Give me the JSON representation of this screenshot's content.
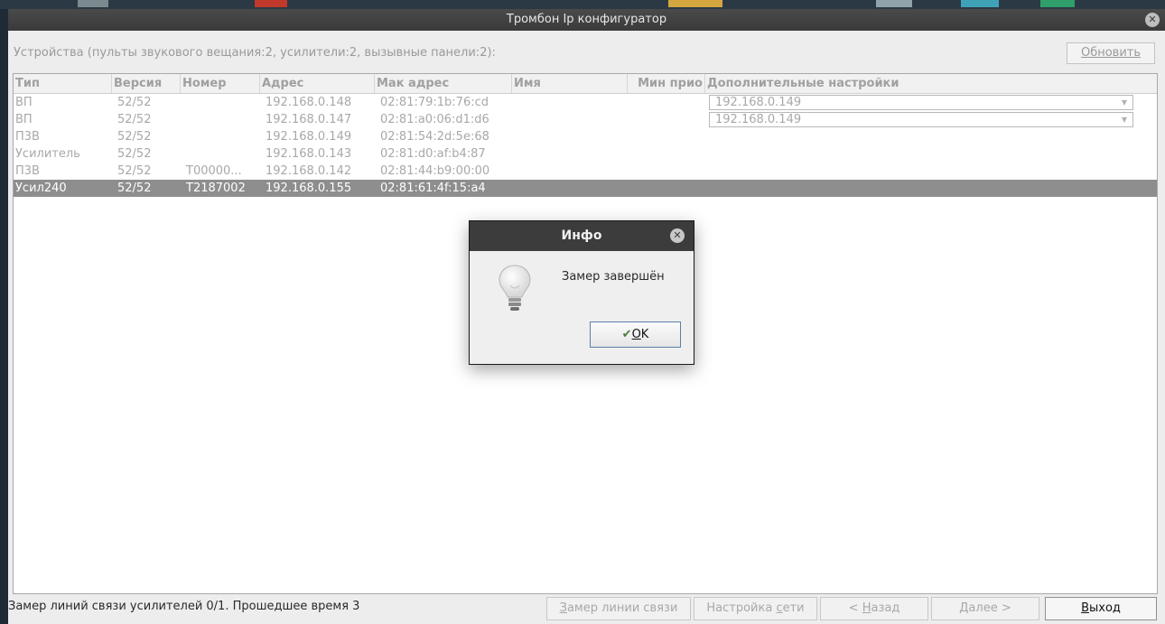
{
  "window": {
    "title": "Тромбон Ip конфигуратор",
    "close_glyph": "✕"
  },
  "devices_label": "Устройства (пульты звукового вещания:2, усилители:2, вызывные панели:2):",
  "refresh_button": "Обновить",
  "table": {
    "headers": [
      "Тип",
      "Версия",
      "Номер",
      "Адрес",
      "Мак адрес",
      "Имя",
      "Мин прио",
      "Дополнительные настройки"
    ],
    "rows": [
      {
        "type": "ВП",
        "version": "52/52",
        "number": "",
        "address": "192.168.0.148",
        "mac": "02:81:79:1b:76:cd",
        "name": "",
        "min_prio": "",
        "extra": "192.168.0.149"
      },
      {
        "type": "ВП",
        "version": "52/52",
        "number": "",
        "address": "192.168.0.147",
        "mac": "02:81:a0:06:d1:d6",
        "name": "",
        "min_prio": "",
        "extra": "192.168.0.149"
      },
      {
        "type": "П3В",
        "version": "52/52",
        "number": "",
        "address": "192.168.0.149",
        "mac": "02:81:54:2d:5e:68",
        "name": "",
        "min_prio": "",
        "extra": ""
      },
      {
        "type": "Усилитель",
        "version": "52/52",
        "number": "",
        "address": "192.168.0.143",
        "mac": "02:81:d0:af:b4:87",
        "name": "",
        "min_prio": "",
        "extra": ""
      },
      {
        "type": "П3В",
        "version": "52/52",
        "number": "T00000...",
        "address": "192.168.0.142",
        "mac": "02:81:44:b9:00:00",
        "name": "",
        "min_prio": "",
        "extra": ""
      },
      {
        "type": "Усил240",
        "version": "52/52",
        "number": "T2187002",
        "address": "192.168.0.155",
        "mac": "02:81:61:4f:15:a4",
        "name": "",
        "min_prio": "",
        "extra": ""
      }
    ],
    "selected_row": 5
  },
  "status_text": "Замер линий связи усилителей 0/1. Прошедшее время 3",
  "buttons": {
    "measure_pre": "",
    "measure_u": "З",
    "measure_post": "амер линии связи",
    "network_pre": "Настройка ",
    "network_u": "с",
    "network_post": "ети",
    "back_pre": "< ",
    "back_u": "Н",
    "back_post": "азад",
    "next_pre": "",
    "next_u": "Д",
    "next_post": "алее >",
    "exit_pre": "",
    "exit_u": "В",
    "exit_post": "ыход"
  },
  "dialog": {
    "title": "Инфо",
    "close_glyph": "✕",
    "message": "Замер завершён",
    "ok_glyph": "✔",
    "ok_u": "O",
    "ok_post": "K"
  },
  "icons": {
    "window_close": "close-icon",
    "dialog_close": "close-icon",
    "dialog_info": "lightbulb-icon",
    "ok": "checkmark-icon",
    "combo": "chevron-down-icon"
  }
}
